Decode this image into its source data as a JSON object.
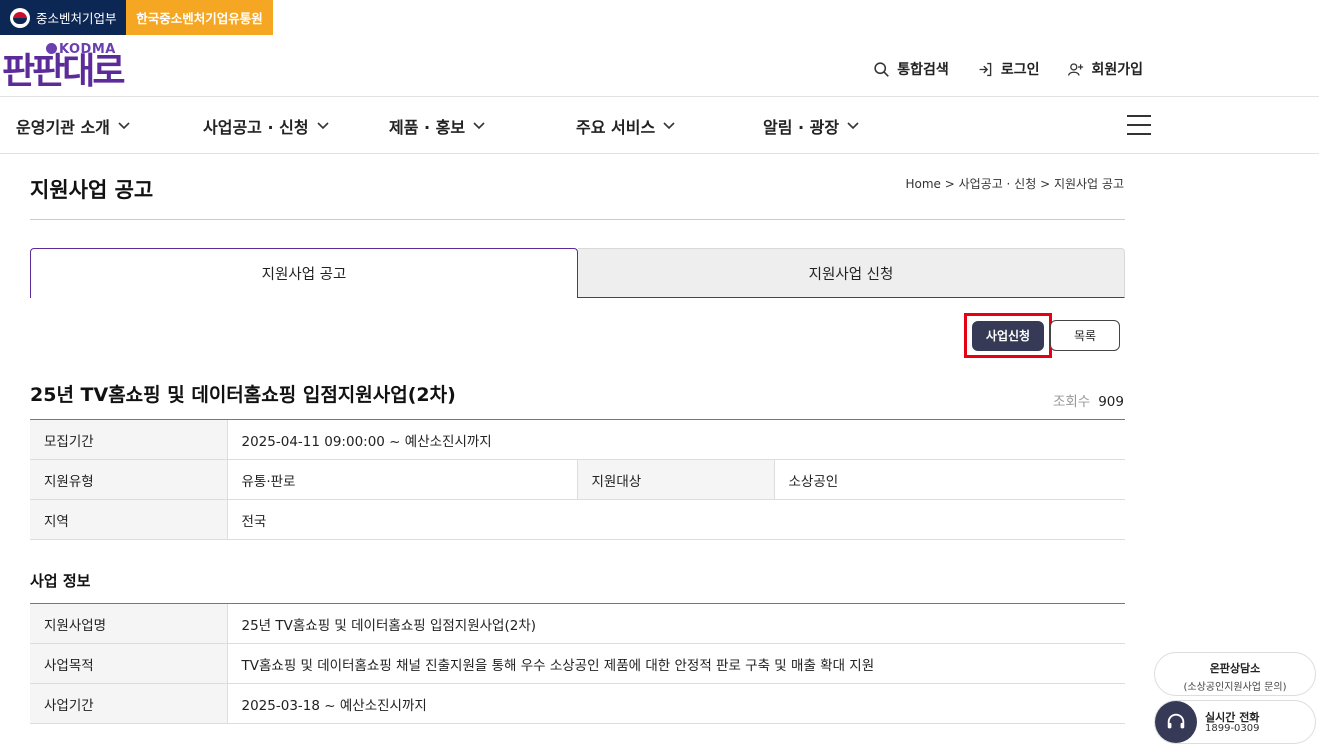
{
  "gov": {
    "ministry": "중소벤처기업부",
    "agency": "한국중소벤처기업유통원"
  },
  "logo": {
    "sub": "KODMA",
    "main": "판판대로"
  },
  "util": {
    "search": "통합검색",
    "login": "로그인",
    "signup": "회원가입"
  },
  "gnb": [
    {
      "label": "운영기관 소개"
    },
    {
      "label": "사업공고 · 신청"
    },
    {
      "label": "제품 · 홍보"
    },
    {
      "label": "주요 서비스"
    },
    {
      "label": "알림 · 광장"
    }
  ],
  "page": {
    "title": "지원사업 공고",
    "breadcrumb": "Home > 사업공고 · 신청 > 지원사업 공고"
  },
  "tabs": {
    "notice": "지원사업 공고",
    "apply": "지원사업 신청"
  },
  "buttons": {
    "apply": "사업신청",
    "list": "목록"
  },
  "post": {
    "title": "25년 TV홈쇼핑 및 데이터홈쇼핑 입점지원사업(2차)",
    "views_label": "조회수",
    "views": "909"
  },
  "summary": {
    "period_label": "모집기간",
    "period_value": "2025-04-11 09:00:00 ~ 예산소진시까지",
    "type_label": "지원유형",
    "type_value": "유통·판로",
    "target_label": "지원대상",
    "target_value": "소상공인",
    "region_label": "지역",
    "region_value": "전국"
  },
  "info": {
    "section_title": "사업 정보",
    "name_label": "지원사업명",
    "name_value": "25년 TV홈쇼핑 및 데이터홈쇼핑 입점지원사업(2차)",
    "purpose_label": "사업목적",
    "purpose_value": "TV홈쇼핑 및 데이터홈쇼핑 채널 진출지원을 통해 우수 소상공인 제품에 대한 안정적 판로 구축 및 매출 확대 지원",
    "duration_label": "사업기간",
    "duration_value": "2025-03-18 ~ 예산소진시까지"
  },
  "float": {
    "consult_title": "온판상담소",
    "consult_sub": "(소상공인지원사업 문의)",
    "call_title": "실시간 전화",
    "call_number": "1899-0309"
  },
  "colors": {
    "brand": "#5b2b9a",
    "navy": "#0d2755",
    "orange": "#f5a623",
    "button": "#363a57",
    "highlight": "#e60012"
  }
}
